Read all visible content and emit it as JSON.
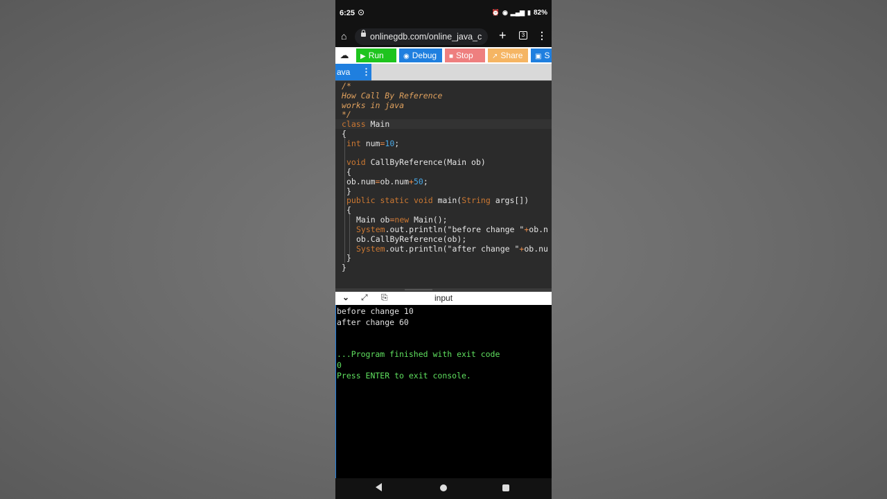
{
  "status_bar": {
    "time": "6:25",
    "battery": "82%",
    "icons": [
      "alarm-icon",
      "eye-icon",
      "volte-icon",
      "lte-icon",
      "signal-icon",
      "battery-icon"
    ]
  },
  "browser": {
    "url": "onlinegdb.com/online_java_c",
    "tab_count": "3"
  },
  "toolbar": {
    "run_label": "Run",
    "debug_label": "Debug",
    "stop_label": "Stop",
    "share_label": "Share",
    "save_label": "S",
    "colors": {
      "run": "#1ec41e",
      "debug": "#1f7fdf",
      "stop": "#ee7f7f",
      "share": "#f5b563"
    }
  },
  "file_tab": {
    "label": "ava"
  },
  "editor": {
    "lines": [
      "/*",
      "How Call By Reference",
      "works in java",
      "*/",
      "class Main",
      "{",
      "int num=10;",
      "",
      "void CallByReference(Main ob)",
      "{",
      "ob.num=ob.num+50;",
      "}",
      "public static void main(String args[])",
      "{",
      "Main ob=new Main();",
      "System.out.println(\"before change \"+ob.n",
      "ob.CallByReference(ob);",
      "System.out.println(\"after change \"+ob.nu",
      "}",
      "}"
    ]
  },
  "console_header": {
    "label": "input"
  },
  "console": {
    "output": [
      "before change 10",
      "after change 60"
    ],
    "finish": [
      "...Program finished with exit code",
      "0",
      "Press ENTER to exit console."
    ]
  }
}
